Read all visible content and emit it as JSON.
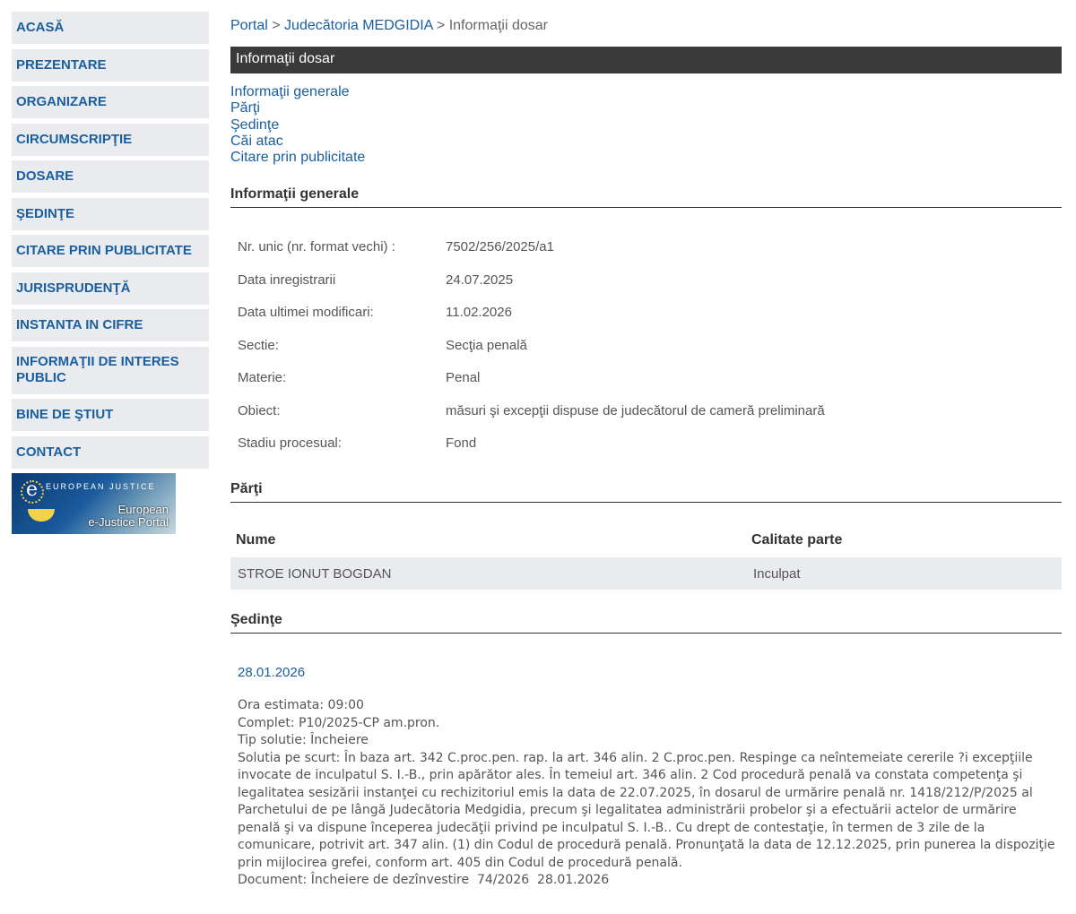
{
  "sidebar": {
    "items": [
      {
        "label": "ACASĂ"
      },
      {
        "label": "PREZENTARE"
      },
      {
        "label": "ORGANIZARE"
      },
      {
        "label": "CIRCUMSCRIPŢIE"
      },
      {
        "label": "DOSARE"
      },
      {
        "label": "ŞEDINŢE"
      },
      {
        "label": "CITARE PRIN PUBLICITATE"
      },
      {
        "label": "JURISPRUDENŢĂ"
      },
      {
        "label": "INSTANTA IN CIFRE"
      },
      {
        "label": "INFORMAŢII DE INTERES PUBLIC"
      },
      {
        "label": "BINE DE ŞTIUT"
      },
      {
        "label": "CONTACT"
      }
    ],
    "banner": {
      "top_text": "EUROPEAN JUSTICE",
      "line1": "European",
      "line2": "e-Justice Portal"
    }
  },
  "breadcrumb": {
    "portal": "Portal",
    "sep": ">",
    "court": "Judecătoria MEDGIDIA",
    "current": "Informaţii dosar"
  },
  "page_title": "Informaţii dosar",
  "toc": [
    "Informaţii generale",
    "Părţi",
    "Şedinţe",
    "Căi atac",
    "Citare prin publicitate"
  ],
  "general": {
    "heading": "Informaţii generale",
    "rows": [
      {
        "label": "Nr. unic (nr. format vechi) :",
        "value": "7502/256/2025/a1"
      },
      {
        "label": "Data inregistrarii",
        "value": "24.07.2025"
      },
      {
        "label": "Data ultimei modificari:",
        "value": "11.02.2026"
      },
      {
        "label": "Sectie:",
        "value": "Secţia penală"
      },
      {
        "label": "Materie:",
        "value": "Penal"
      },
      {
        "label": "Obiect:",
        "value": "măsuri şi excepţii dispuse de judecătorul de cameră preliminară"
      },
      {
        "label": "Stadiu procesual:",
        "value": "Fond"
      }
    ]
  },
  "parties": {
    "heading": "Părţi",
    "col_name": "Nume",
    "col_role": "Calitate parte",
    "rows": [
      {
        "name": "STROE IONUT BOGDAN",
        "role": "Inculpat"
      }
    ]
  },
  "sessions": {
    "heading": "Şedinţe",
    "date": "28.01.2026",
    "ora": "Ora estimata: 09:00",
    "complet": "Complet: P10/2025-CP am.pron.",
    "tip": "Tip solutie: Încheiere",
    "solutia": "Solutia pe scurt: În baza art. 342 C.proc.pen. rap. la art. 346 alin. 2 C.proc.pen. Respinge ca neîntemeiate cererile ?i excepţiile invocate de inculpatul S. I.-B., prin apărător ales. În temeiul art. 346 alin. 2 Cod procedură penală va constata competenţa şi legalitatea sesizării instanţei cu rechizitoriul emis la data de 22.07.2025, în dosarul de urmărire penală nr. 1418/212/P/2025 al Parchetului de pe lângă Judecătoria Medgidia, precum şi legalitatea administrării probelor şi a efectuării actelor de urmărire penală şi va dispune începerea judecăţii privind pe inculpatul S. I.-B.. Cu drept de contestaţie, în termen de 3 zile de la comunicare, potrivit art. 347 alin. (1) din Codul de procedură penală. Pronunţată la data de 12.12.2025, prin punerea la dispoziţie prin mijlocirea grefei, conform art. 405 din Codul de procedură penală.",
    "document": "Document: Încheiere de dezînvestire  74/2026  28.01.2026"
  }
}
